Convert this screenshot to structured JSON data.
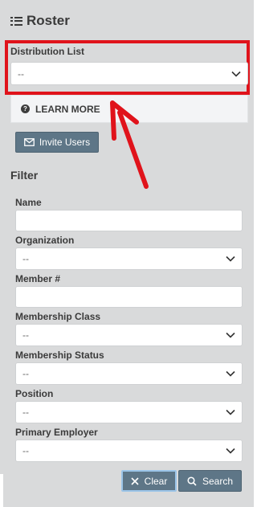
{
  "header": {
    "title": "Roster",
    "icon": "list-icon"
  },
  "distribution": {
    "label": "Distribution List",
    "value": "--"
  },
  "learn_more": {
    "label": "LEARN MORE",
    "icon": "question-circle-icon"
  },
  "invite": {
    "label": "Invite Users",
    "icon": "envelope-icon"
  },
  "filter": {
    "heading": "Filter",
    "name_label": "Name",
    "name_value": "",
    "organization_label": "Organization",
    "organization_value": "--",
    "member_label": "Member #",
    "member_value": "",
    "class_label": "Membership Class",
    "class_value": "--",
    "status_label": "Membership Status",
    "status_value": "--",
    "position_label": "Position",
    "position_value": "--",
    "employer_label": "Primary Employer",
    "employer_value": "--"
  },
  "actions": {
    "clear_label": "Clear",
    "search_label": "Search"
  },
  "colors": {
    "panel": "#d9dadb",
    "highlight": "#e0131b",
    "button": "#5e7687",
    "focus_ring": "#9bc4e8"
  }
}
